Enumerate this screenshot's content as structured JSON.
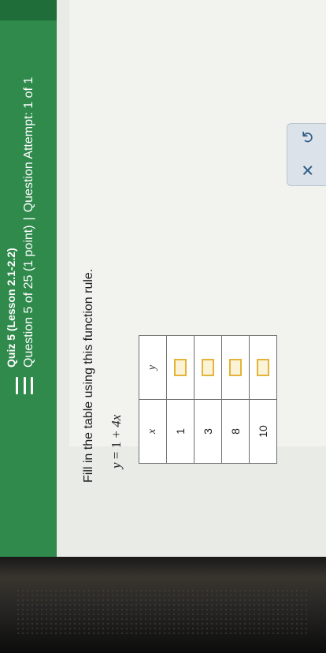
{
  "header": {
    "quiz_title": "Quiz 5 (Lesson 2.1-2.2)",
    "question_label": "Question 5 of 25 (1 point)",
    "separator": "|",
    "attempt_label": "Question Attempt: 1 of 1"
  },
  "question": {
    "prompt": "Fill in the table using this function rule.",
    "equation": {
      "lhs": "y",
      "eq": "=",
      "a": "1",
      "plus": "+",
      "b": "4x"
    }
  },
  "table": {
    "headers": [
      "x",
      "y"
    ],
    "rows": [
      {
        "x": "1",
        "y": ""
      },
      {
        "x": "3",
        "y": ""
      },
      {
        "x": "8",
        "y": ""
      },
      {
        "x": "10",
        "y": ""
      }
    ]
  },
  "toolbar": {
    "clear_icon": "close-icon",
    "clear_glyph": "✕",
    "undo_icon": "undo-icon",
    "undo_glyph": "↺"
  },
  "colors": {
    "header_green": "#2f8a4c",
    "answer_box_border": "#e4b43a",
    "tool_icon": "#2c5a86"
  }
}
